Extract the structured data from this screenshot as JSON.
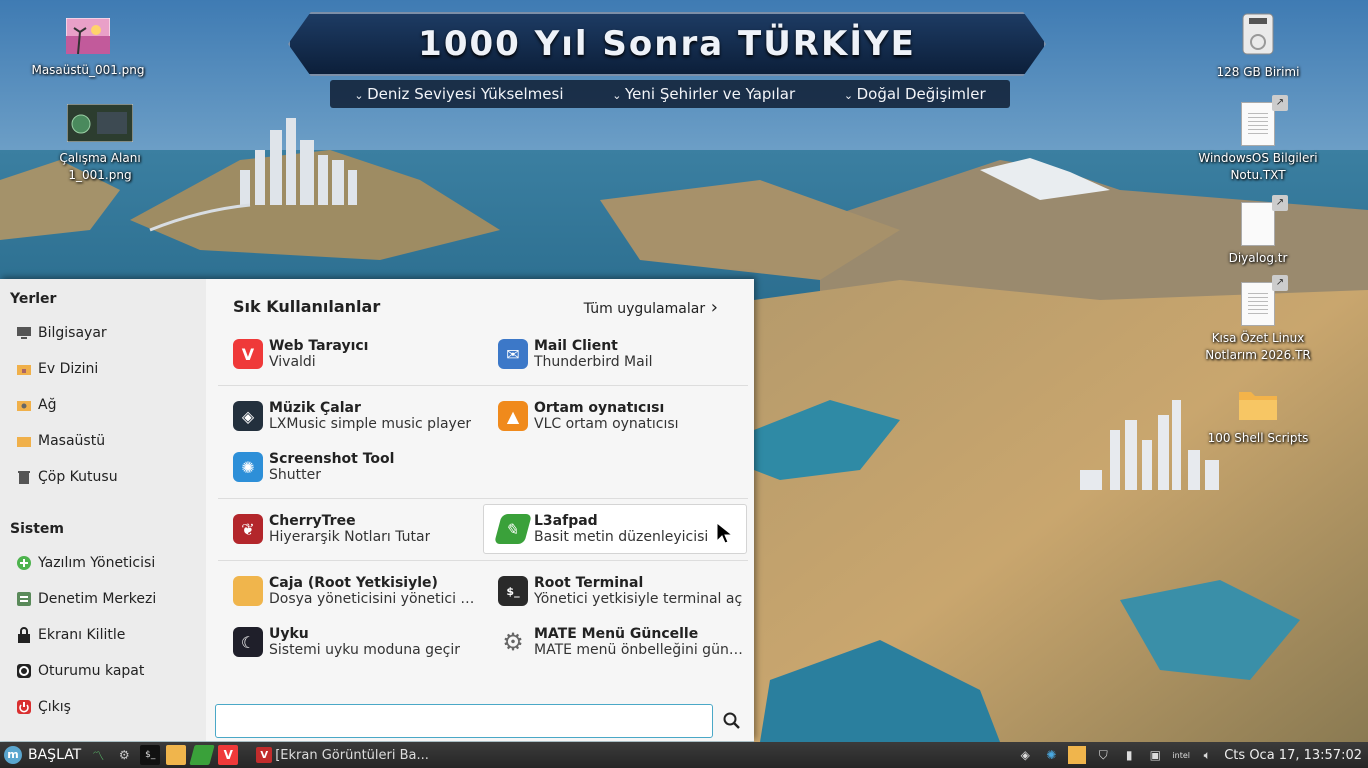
{
  "banner": {
    "title": "1000 Yıl Sonra TÜRKİYE",
    "subtitles": [
      "Deniz Seviyesi Yükselmesi",
      "Yeni Şehirler ve Yapılar",
      "Doğal Değişimler"
    ]
  },
  "desktop_icons": [
    {
      "label": "Masaüstü_001.png",
      "icon": "image-thumbnail-icon"
    },
    {
      "label": "Çalışma Alanı 1_001.png",
      "icon": "image-thumbnail-icon"
    },
    {
      "label": "128 GB Birimi",
      "icon": "drive-icon"
    },
    {
      "label": "WindowsOS Bilgileri Notu.TXT",
      "icon": "text-file-icon"
    },
    {
      "label": "Diyalog.tr",
      "icon": "file-icon"
    },
    {
      "label": "Kısa Özet Linux Notlarım 2026.TR",
      "icon": "text-file-icon"
    },
    {
      "label": "100 Shell Scripts",
      "icon": "folder-icon"
    }
  ],
  "menu": {
    "places_header": "Yerler",
    "places": [
      {
        "label": "Bilgisayar",
        "icon": "computer-icon"
      },
      {
        "label": "Ev Dizini",
        "icon": "home-folder-icon"
      },
      {
        "label": "Ağ",
        "icon": "network-folder-icon"
      },
      {
        "label": "Masaüstü",
        "icon": "desktop-folder-icon"
      },
      {
        "label": "Çöp Kutusu",
        "icon": "trash-icon"
      }
    ],
    "system_header": "Sistem",
    "system": [
      {
        "label": "Yazılım Yöneticisi",
        "icon": "software-manager-icon"
      },
      {
        "label": "Denetim Merkezi",
        "icon": "control-center-icon"
      },
      {
        "label": "Ekranı Kilitle",
        "icon": "lock-icon"
      },
      {
        "label": "Oturumu kapat",
        "icon": "logout-icon"
      },
      {
        "label": "Çıkış",
        "icon": "power-icon"
      }
    ],
    "favorites_title": "Sık Kullanılanlar",
    "all_apps_label": "Tüm uygulamalar",
    "apps": [
      {
        "name": "Web Tarayıcı",
        "desc": "Vivaldi",
        "icon": "vivaldi-icon",
        "color": "#ef3939"
      },
      {
        "name": "Mail Client",
        "desc": "Thunderbird Mail",
        "icon": "mail-icon",
        "color": "#3c78c8"
      },
      {
        "name": "Müzik Çalar",
        "desc": "LXMusic simple music player",
        "icon": "music-player-icon",
        "color": "#23303d"
      },
      {
        "name": "Ortam oynatıcısı",
        "desc": "VLC ortam oynatıcısı",
        "icon": "vlc-icon",
        "color": "#f08a1c"
      },
      {
        "name": "Screenshot Tool",
        "desc": "Shutter",
        "icon": "shutter-icon",
        "color": "#2d8fd8"
      },
      {
        "name": "CherryTree",
        "desc": "Hiyerarşik Notları Tutar",
        "icon": "cherrytree-icon",
        "color": "#b3262b"
      },
      {
        "name": "L3afpad",
        "desc": "Basit metin düzenleyicisi",
        "icon": "l3afpad-icon",
        "color": "#3aa13a"
      },
      {
        "name": "Caja (Root Yetkisiyle)",
        "desc": "Dosya yöneticisini yönetici olarak aç",
        "icon": "folder-icon",
        "color": "#f0b54c"
      },
      {
        "name": "Root Terminal",
        "desc": "Yönetici yetkisiyle terminal aç",
        "icon": "terminal-icon",
        "color": "#2a2a2a"
      },
      {
        "name": "Uyku",
        "desc": "Sistemi uyku moduna geçir",
        "icon": "moon-icon",
        "color": "#1f1f2a"
      },
      {
        "name": "MATE Menü Güncelle",
        "desc": "MATE menü önbelleğini güncelle",
        "icon": "gear-icon",
        "color": "#888888"
      }
    ],
    "search": {
      "placeholder": "",
      "value": ""
    }
  },
  "panel": {
    "start_label": "BAŞLAT",
    "launchers": [
      "system-monitor-icon",
      "settings-icon",
      "terminal-icon",
      "file-manager-icon",
      "l3afpad-icon",
      "vivaldi-icon"
    ],
    "task": {
      "label": "[Ekran Görüntüleri Ba...",
      "icon": "vivaldi-icon"
    },
    "tray": [
      "vpn-icon",
      "sync-icon",
      "folder-icon",
      "shield-icon",
      "battery-icon",
      "window-icon",
      "intel-icon",
      "volume-icon"
    ],
    "clock": "Cts Oca 17, 13:57:02"
  }
}
